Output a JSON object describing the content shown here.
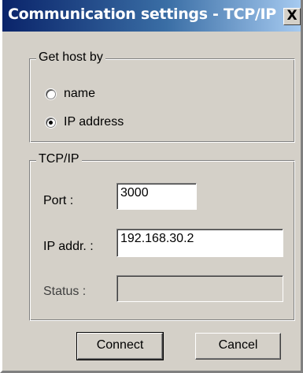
{
  "window": {
    "title": "Communication settings - TCP/IP",
    "close_label": "X"
  },
  "host_group": {
    "legend": "Get host by",
    "options": [
      {
        "label": "name",
        "selected": false
      },
      {
        "label": "IP address",
        "selected": true
      }
    ]
  },
  "tcp_group": {
    "legend": "TCP/IP",
    "port_label": "Port :",
    "port_value": "3000",
    "ip_label": "IP  addr. :",
    "ip_value": "192.168.30.2",
    "status_label": "Status :",
    "status_value": ""
  },
  "buttons": {
    "connect": "Connect",
    "cancel": "Cancel"
  },
  "colors": {
    "titlebar_start": "#0a246a",
    "titlebar_end": "#a6caf0",
    "face": "#d4d0c8"
  }
}
